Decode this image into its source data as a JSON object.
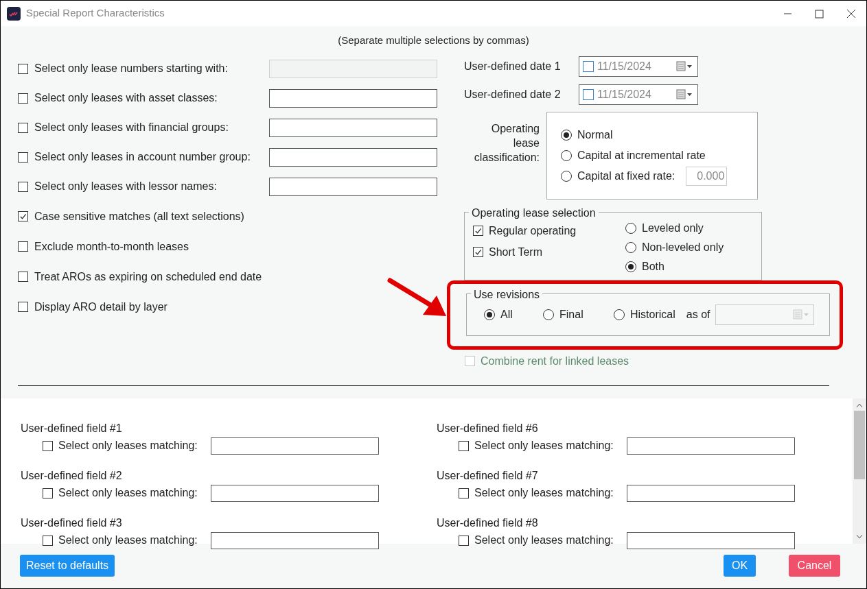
{
  "window": {
    "title": "Special Report Characteristics"
  },
  "hint": "(Separate multiple selections by commas)",
  "filters": [
    {
      "kind": "text-filter",
      "label": "Select only lease numbers starting with:",
      "checked": false,
      "disabled": true
    },
    {
      "kind": "text-filter",
      "label": "Select only leases with asset classes:",
      "checked": false,
      "disabled": false
    },
    {
      "kind": "text-filter",
      "label": "Select only leases with financial groups:",
      "checked": false,
      "disabled": false
    },
    {
      "kind": "text-filter",
      "label": "Select only leases in account number group:",
      "checked": false,
      "disabled": false
    },
    {
      "kind": "text-filter",
      "label": "Select only leases with lessor names:",
      "checked": false,
      "disabled": false
    },
    {
      "kind": "option",
      "label": "Case sensitive matches (all text selections)",
      "checked": true
    },
    {
      "kind": "option",
      "label": "Exclude month-to-month leases",
      "checked": false
    },
    {
      "kind": "option",
      "label": "Treat AROs as expiring on scheduled end date",
      "checked": false
    },
    {
      "kind": "option",
      "label": "Display ARO detail by layer",
      "checked": false
    }
  ],
  "dates": [
    {
      "label": "User-defined date 1",
      "checked": false,
      "value": "11/15/2024"
    },
    {
      "label": "User-defined date 2",
      "checked": false,
      "value": "11/15/2024"
    }
  ],
  "classification": {
    "label": "Operating lease classification:",
    "options": [
      {
        "label": "Normal",
        "selected": true
      },
      {
        "label": "Capital at incremental rate",
        "selected": false
      },
      {
        "label": "Capital at fixed rate:",
        "selected": false,
        "rate": "0.000"
      }
    ]
  },
  "selection": {
    "title": "Operating lease selection",
    "types": [
      {
        "label": "Regular operating",
        "checked": true
      },
      {
        "label": "Short Term",
        "checked": true
      }
    ],
    "leveling": [
      {
        "label": "Leveled only",
        "selected": false
      },
      {
        "label": "Non-leveled only",
        "selected": false
      },
      {
        "label": "Both",
        "selected": true
      }
    ]
  },
  "revisions": {
    "title": "Use revisions",
    "options": [
      {
        "label": "All",
        "selected": true
      },
      {
        "label": "Final",
        "selected": false
      },
      {
        "label": "Historical",
        "selected": false
      }
    ],
    "as_of_label": "as of",
    "highlighted": true
  },
  "combine_rent": {
    "label": "Combine rent for linked leases",
    "checked": false,
    "disabled": true
  },
  "user_fields": [
    {
      "title": "User-defined field #1",
      "label": "Select only leases matching:",
      "checked": false
    },
    {
      "title": "User-defined field #6",
      "label": "Select only leases matching:",
      "checked": false
    },
    {
      "title": "User-defined field #2",
      "label": "Select only leases matching:",
      "checked": false
    },
    {
      "title": "User-defined field #7",
      "label": "Select only leases matching:",
      "checked": false
    },
    {
      "title": "User-defined field #3",
      "label": "Select only leases matching:",
      "checked": false
    },
    {
      "title": "User-defined field #8",
      "label": "Select only leases matching:",
      "checked": false
    }
  ],
  "buttons": {
    "reset": "Reset to defaults",
    "ok": "OK",
    "cancel": "Cancel"
  }
}
